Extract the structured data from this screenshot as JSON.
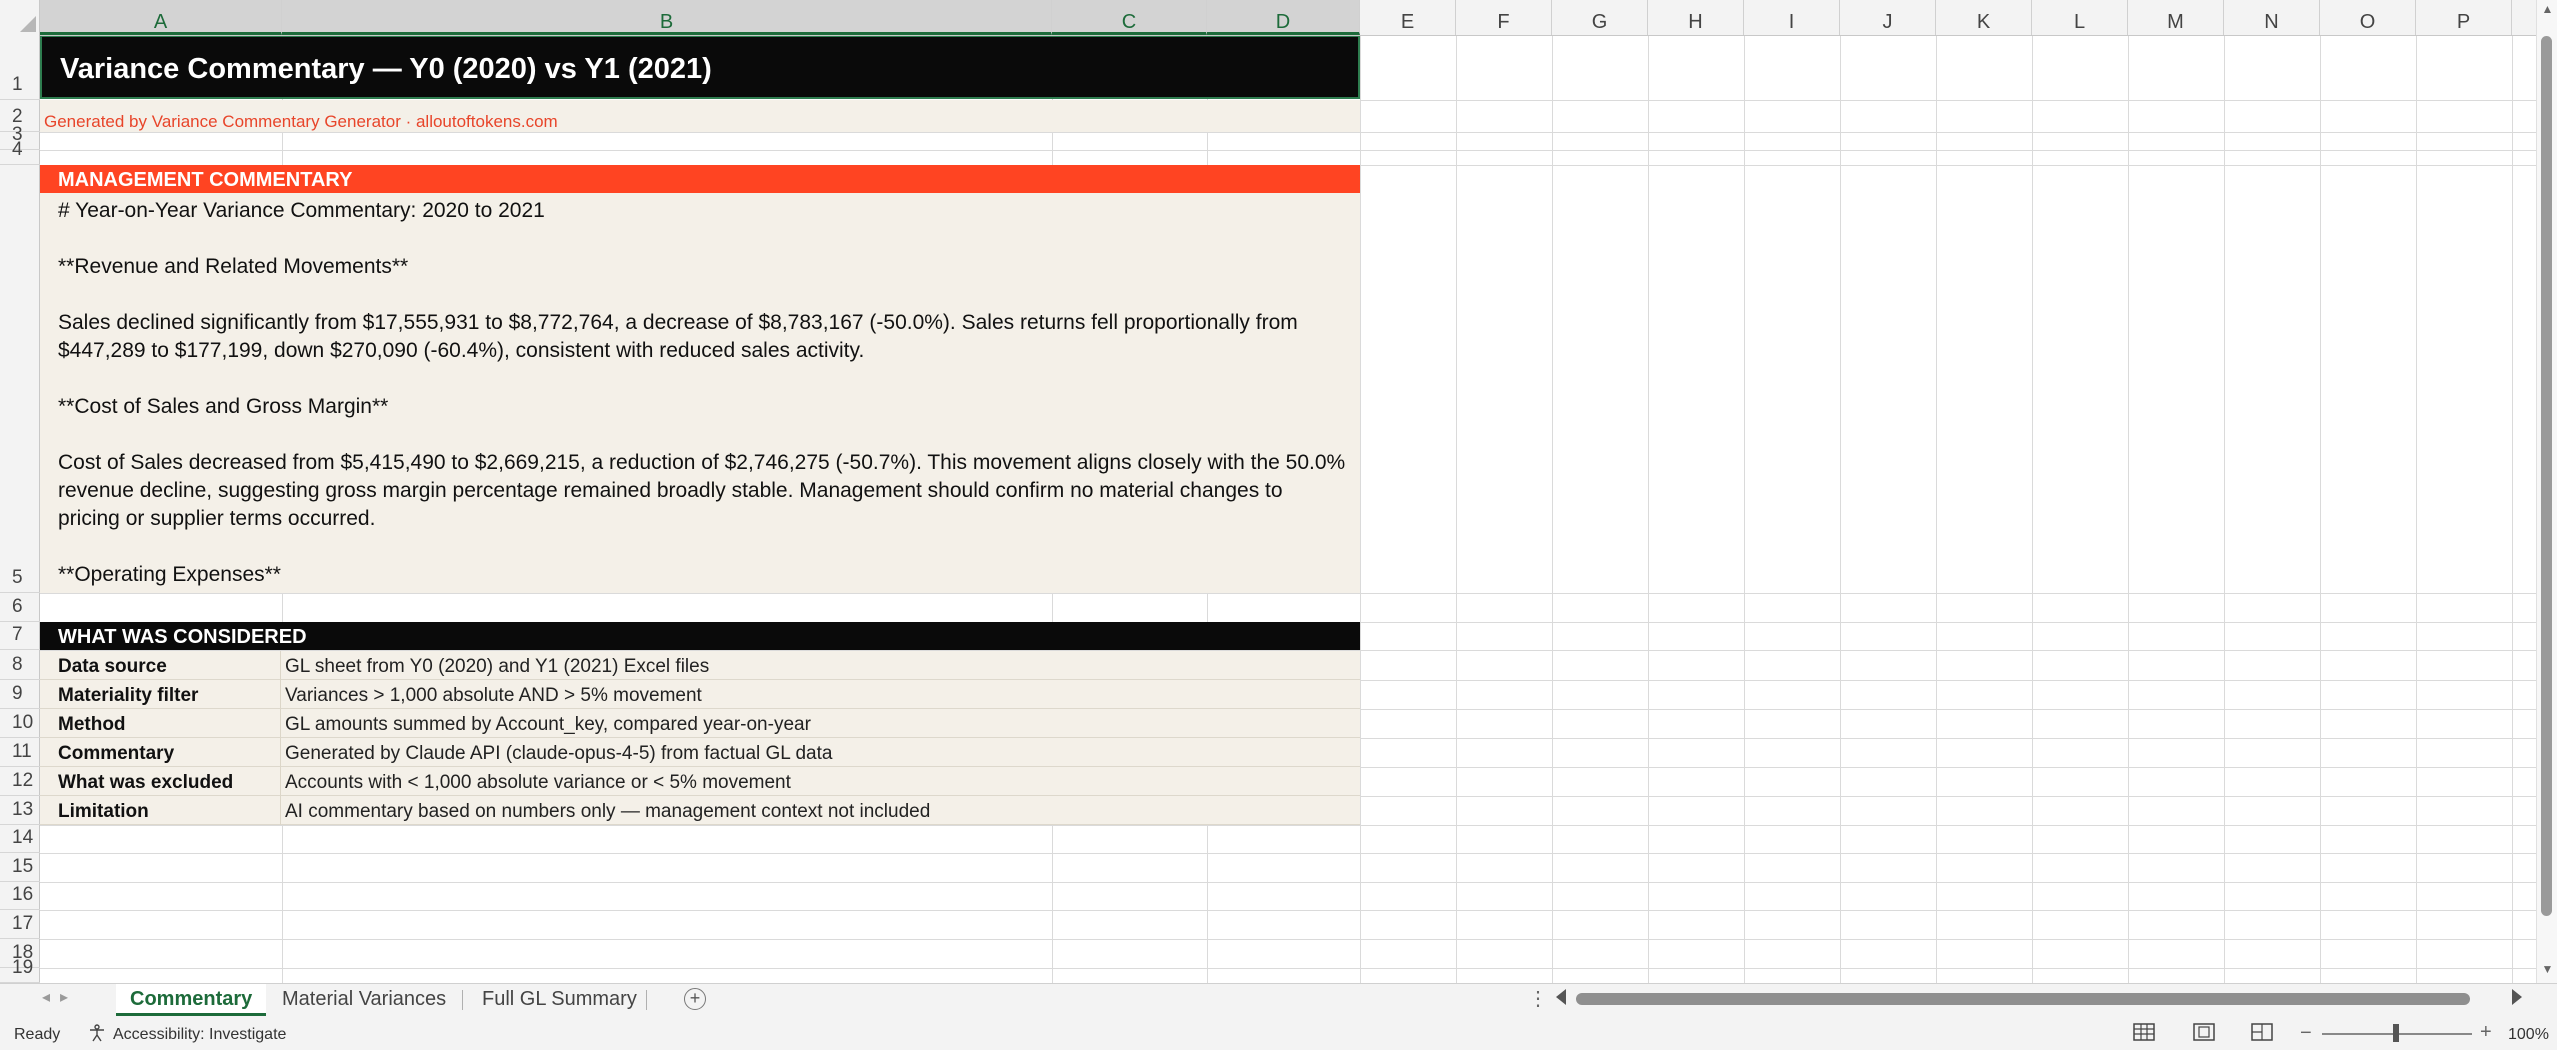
{
  "columns": [
    "A",
    "B",
    "C",
    "D",
    "E",
    "F",
    "G",
    "H",
    "I",
    "J",
    "K",
    "L",
    "M",
    "N",
    "O",
    "P"
  ],
  "selected_columns": [
    "A",
    "B",
    "C",
    "D"
  ],
  "rows": [
    "1",
    "2",
    "3",
    "4",
    "5",
    "6",
    "7",
    "8",
    "9",
    "10",
    "11",
    "12",
    "13",
    "14",
    "15",
    "16",
    "17",
    "18",
    "19"
  ],
  "sheet": {
    "title": "Variance Commentary — Y0 (2020) vs Y1 (2021)",
    "generated_by": "Generated by Variance Commentary Generator · alloutoftokens.com",
    "management_commentary_header": "MANAGEMENT COMMENTARY",
    "commentary_paragraphs": [
      "# Year-on-Year Variance Commentary: 2020 to 2021",
      "**Revenue and Related Movements**",
      "Sales declined significantly from $17,555,931 to $8,772,764, a decrease of $8,783,167 (-50.0%). Sales returns fell proportionally from $447,289 to $177,199, down $270,090 (-60.4%), consistent with reduced sales activity.",
      "**Cost of Sales and Gross Margin**",
      "Cost of Sales decreased from $5,415,490 to $2,669,215, a reduction of $2,746,275 (-50.7%). This movement aligns closely with the 50.0% revenue decline, suggesting gross margin percentage remained broadly stable. Management should confirm no material changes to pricing or supplier terms occurred.",
      "**Operating Expenses**"
    ],
    "what_was_considered_header": "WHAT WAS CONSIDERED",
    "considered": [
      {
        "key": "Data source",
        "value": "GL sheet from Y0 (2020) and Y1 (2021) Excel files"
      },
      {
        "key": "Materiality filter",
        "value": "Variances > 1,000 absolute AND > 5% movement"
      },
      {
        "key": "Method",
        "value": "GL amounts summed by Account_key, compared year-on-year"
      },
      {
        "key": "Commentary",
        "value": "Generated by Claude API (claude-opus-4-5) from factual GL data"
      },
      {
        "key": "What was excluded",
        "value": "Accounts with < 1,000 absolute variance or < 5% movement"
      },
      {
        "key": "Limitation",
        "value": "AI commentary based on numbers only — management context not included"
      }
    ]
  },
  "tabs": [
    {
      "label": "Commentary",
      "active": true
    },
    {
      "label": "Material Variances",
      "active": false
    },
    {
      "label": "Full GL Summary",
      "active": false
    }
  ],
  "status": {
    "ready": "Ready",
    "accessibility": "Accessibility: Investigate",
    "zoom": "100%"
  },
  "colors": {
    "accent": "#1d6b3a",
    "title_bg": "#0a0a0a",
    "orange": "#ff4422",
    "cream": "#f4f0e8",
    "gen_text": "#e8452a"
  }
}
